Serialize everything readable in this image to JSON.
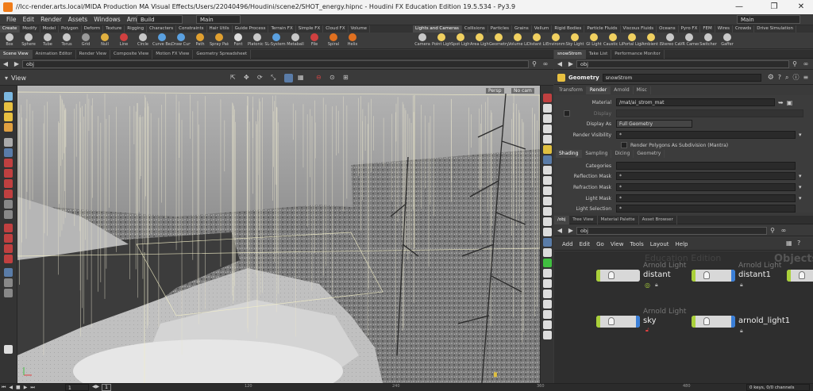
{
  "window": {
    "title": "//lcc-render.arts.local/MIDA Production MA Visual Effects/Users/22040496/Houdini/scene2/SHOT_energy.hipnc - Houdini FX Education Edition 19.5.534 - Py3.9",
    "minimize": "—",
    "maximize": "❐",
    "close": "✕"
  },
  "menu": {
    "items": [
      "File",
      "Edit",
      "Render",
      "Assets",
      "Windows",
      "Arnold",
      "Help"
    ],
    "build": "Build",
    "main_left": "Main",
    "main_right": "Main"
  },
  "shelf_tabs_left": [
    "Create",
    "Modify",
    "Model",
    "Polygon",
    "Deform",
    "Texture",
    "Rigging",
    "Characters",
    "Constraints",
    "Hair Utils",
    "Guide Process",
    "Terrain FX",
    "Simple FX",
    "Cloud FX",
    "Volume"
  ],
  "shelf_tabs_right": [
    "Lights and Cameras",
    "Collisions",
    "Particles",
    "Grains",
    "Vellum",
    "Rigid Bodies",
    "Particle Fluids",
    "Viscous Fluids",
    "Oceans",
    "Pyro FX",
    "FEM",
    "Wires",
    "Crowds",
    "Drive Simulation"
  ],
  "shelf_tools_left": [
    {
      "label": "Box",
      "color": "#c8c8c8"
    },
    {
      "label": "Sphere",
      "color": "#c8c8c8"
    },
    {
      "label": "Tube",
      "color": "#c8c8c8"
    },
    {
      "label": "Torus",
      "color": "#c8c8c8"
    },
    {
      "label": "Grid",
      "color": "#9a9a9a"
    },
    {
      "label": "Null",
      "color": "#e0b040"
    },
    {
      "label": "Line",
      "color": "#d04040"
    },
    {
      "label": "Circle",
      "color": "#c8c8c8"
    },
    {
      "label": "Curve Bezier",
      "color": "#5aa0e0"
    },
    {
      "label": "Draw Curve",
      "color": "#5aa0e0"
    },
    {
      "label": "Path",
      "color": "#e0a030"
    },
    {
      "label": "Spray Paint",
      "color": "#e0a030"
    },
    {
      "label": "Font",
      "color": "#dddddd"
    },
    {
      "label": "Platonic Solids",
      "color": "#c8c8c8"
    },
    {
      "label": "L-System",
      "color": "#5aa0e0"
    },
    {
      "label": "Metaball",
      "color": "#c8c8c8"
    },
    {
      "label": "File",
      "color": "#d04040"
    },
    {
      "label": "Spiral",
      "color": "#e07020"
    },
    {
      "label": "Helix",
      "color": "#e07020"
    }
  ],
  "shelf_tools_right": [
    {
      "label": "Camera",
      "color": "#c8c8c8"
    },
    {
      "label": "Point Light",
      "color": "#f0d060"
    },
    {
      "label": "Spot Light",
      "color": "#f0d060"
    },
    {
      "label": "Area Light",
      "color": "#f0d060"
    },
    {
      "label": "Geometry Light",
      "color": "#f0d060"
    },
    {
      "label": "Volume Light",
      "color": "#f0d060"
    },
    {
      "label": "Distant Light",
      "color": "#f0d060"
    },
    {
      "label": "Environment Light",
      "color": "#f0d060"
    },
    {
      "label": "Sky Light",
      "color": "#f0d060"
    },
    {
      "label": "GI Light",
      "color": "#f0d060"
    },
    {
      "label": "Caustic Light",
      "color": "#f0d060"
    },
    {
      "label": "Portal Light",
      "color": "#f0d060"
    },
    {
      "label": "Ambient Light",
      "color": "#f0d060"
    },
    {
      "label": "Stereo Camera",
      "color": "#c8c8c8"
    },
    {
      "label": "VR Camera",
      "color": "#c8c8c8"
    },
    {
      "label": "Switcher",
      "color": "#c8c8c8"
    },
    {
      "label": "Gaffer",
      "color": "#c8c8c8"
    }
  ],
  "pane_tabs_left": [
    "Scene View",
    "Animation Editor",
    "Render View",
    "Composite View",
    "Motion FX View",
    "Geometry Spreadsheet"
  ],
  "pane_tabs_right_top": [
    "snowStrom",
    "Take List",
    "Performance Monitor"
  ],
  "path_left": "obj",
  "path_right": "obj",
  "viewport": {
    "title": "View",
    "persp": "Persp",
    "cam": "No cam"
  },
  "params": {
    "node_type": "Geometry",
    "node_name": "snowStrom",
    "tabs": [
      "Transform",
      "Render",
      "Arnold",
      "Misc"
    ],
    "active_tab": "Render",
    "material_label": "Material",
    "material_value": "/mat/ai_strom_mat",
    "display_label": "Display",
    "display_as_label": "Display As",
    "display_as_value": "Full Geometry",
    "render_visibility_label": "Render Visibility",
    "render_visibility_value": "*",
    "subdivision_label": "Render Polygons As Subdivision (Mantra)",
    "subtabs": [
      "Shading",
      "Sampling",
      "Dicing",
      "Geometry"
    ],
    "categories_label": "Categories",
    "reflection_label": "Reflection Mask",
    "reflection_value": "*",
    "refraction_label": "Refraction Mask",
    "refraction_value": "*",
    "light_mask_label": "Light Mask",
    "light_mask_value": "*",
    "light_selection_label": "Light Selection",
    "light_selection_value": "*"
  },
  "network": {
    "tabs": [
      "/obj",
      "Tree View",
      "Material Palette",
      "Asset Browser"
    ],
    "menu": [
      "Add",
      "Edit",
      "Go",
      "View",
      "Tools",
      "Layout",
      "Help"
    ],
    "path": "obj",
    "watermark_left": "Education Edition",
    "watermark_right": "Objects",
    "nodes": [
      {
        "type": "Arnold Light",
        "name": "distant"
      },
      {
        "type": "Arnold Light",
        "name": "distant1"
      },
      {
        "type": "Arnold Light",
        "name": "sky"
      },
      {
        "type": "Arnold Light",
        "name": "arnold_light1"
      }
    ]
  },
  "timeline": {
    "frame": "1",
    "marks": [
      "120",
      "240",
      "360",
      "480"
    ],
    "keys": "0 keys, 0/0 channels"
  },
  "colors": {
    "title_bg": "#f3f3f3",
    "menu_bg": "#3b3b3b",
    "pane_bg": "#3a3a3a",
    "node_green": "#aad03a",
    "node_blue": "#3a7fd8",
    "houdini_orange": "#f07d1a"
  }
}
